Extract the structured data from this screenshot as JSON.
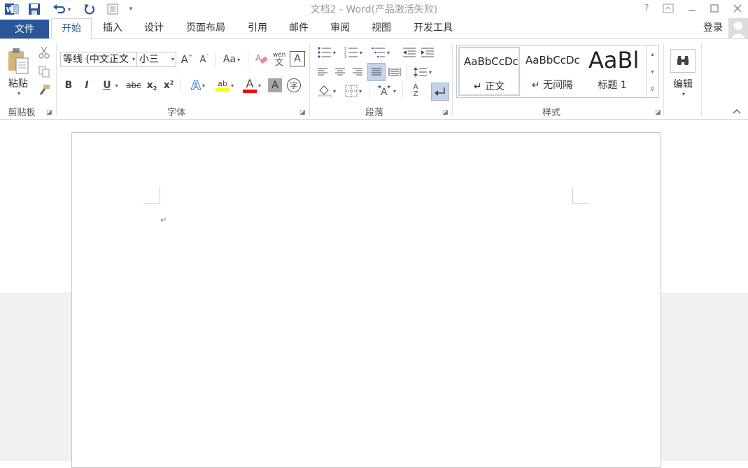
{
  "window": {
    "title": "文档2 - Word(产品激活失败)",
    "help": "?",
    "qat_customize": "▾"
  },
  "tabs": {
    "file": "文件",
    "items": [
      "开始",
      "插入",
      "设计",
      "页面布局",
      "引用",
      "邮件",
      "审阅",
      "视图",
      "开发工具"
    ],
    "active": "开始",
    "login": "登录"
  },
  "ribbon": {
    "clipboard": {
      "label": "剪贴板",
      "paste": "粘贴"
    },
    "font": {
      "label": "字体",
      "font_name": "等线 (中文正文",
      "font_size": "小三",
      "case_btn": "Aa",
      "phonetic_top": "wén",
      "phonetic_bottom": "文",
      "bold": "B",
      "italic": "I",
      "underline": "U",
      "strike": "abc",
      "sub": "x",
      "sub_mark": "2",
      "sup": "x",
      "sup_mark": "2",
      "text_effect": "A",
      "highlight": "ab",
      "font_color": "A",
      "char_shading": "A",
      "encircle": "字",
      "grow": "A",
      "shrink": "A",
      "border_char": "A"
    },
    "paragraph": {
      "label": "段落",
      "sort_top": "A",
      "sort_bottom": "Z"
    },
    "styles": {
      "label": "样式",
      "items": [
        {
          "sample": "AaBbCcDc",
          "name": "↵ 正文"
        },
        {
          "sample": "AaBbCcDc",
          "name": "↵ 无间隔"
        },
        {
          "sample": "AaBl",
          "name": "标题 1"
        }
      ]
    },
    "editing": {
      "label": "编辑"
    }
  },
  "document": {
    "paragraph_mark": "↵"
  },
  "colors": {
    "accent": "#2b579a",
    "highlight": "#ffff00",
    "font_red": "#ff0000"
  }
}
